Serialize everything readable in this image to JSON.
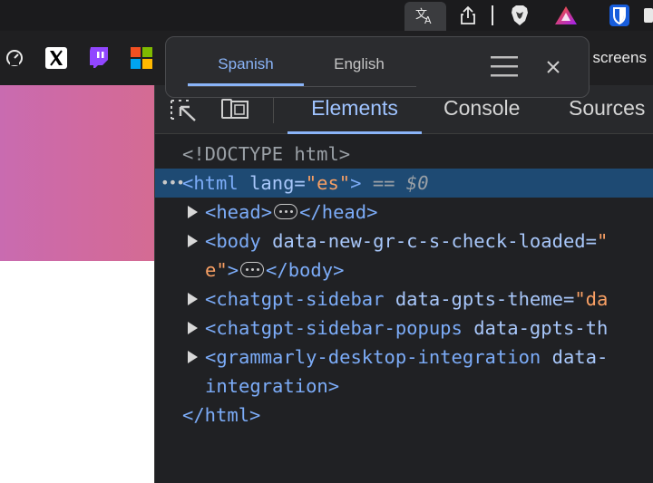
{
  "translate_popup": {
    "tabs": [
      {
        "label": "Spanish",
        "active": true
      },
      {
        "label": "English",
        "active": false
      }
    ]
  },
  "bookmarks": {
    "trailing_text": ": screens"
  },
  "devtools": {
    "tabs": [
      "Elements",
      "Console",
      "Sources"
    ],
    "active_tab": "Elements",
    "dom": {
      "doctype": "<!DOCTYPE html>",
      "html_open_tag": "<html",
      "html_attr": "lang=",
      "html_attr_value": "\"es\"",
      "html_close_bracket": ">",
      "selected_marker": "== $0",
      "head_open": "<head>",
      "head_close": "</head>",
      "body_open": "<body",
      "body_attr": "data-new-gr-c-s-check-loaded=",
      "body_attr_value_start": "\"",
      "body_attr_value_end": "e\"",
      "body_open_bracket": ">",
      "body_close": "</body>",
      "sidebar_open": "<chatgpt-sidebar",
      "sidebar_attr": "data-gpts-theme=",
      "sidebar_attr_value": "\"da",
      "popups_open": "<chatgpt-sidebar-popups",
      "popups_attr": "data-gpts-th",
      "grammarly_open": "<grammarly-desktop-integration",
      "grammarly_attr": "data-",
      "grammarly_cont": "integration>",
      "html_close": "</html>"
    }
  },
  "colors": {
    "accent": "#8ab4f8",
    "selection": "#1e4a73",
    "gradient_start": "#c96bb0",
    "gradient_end": "#d46b93"
  }
}
